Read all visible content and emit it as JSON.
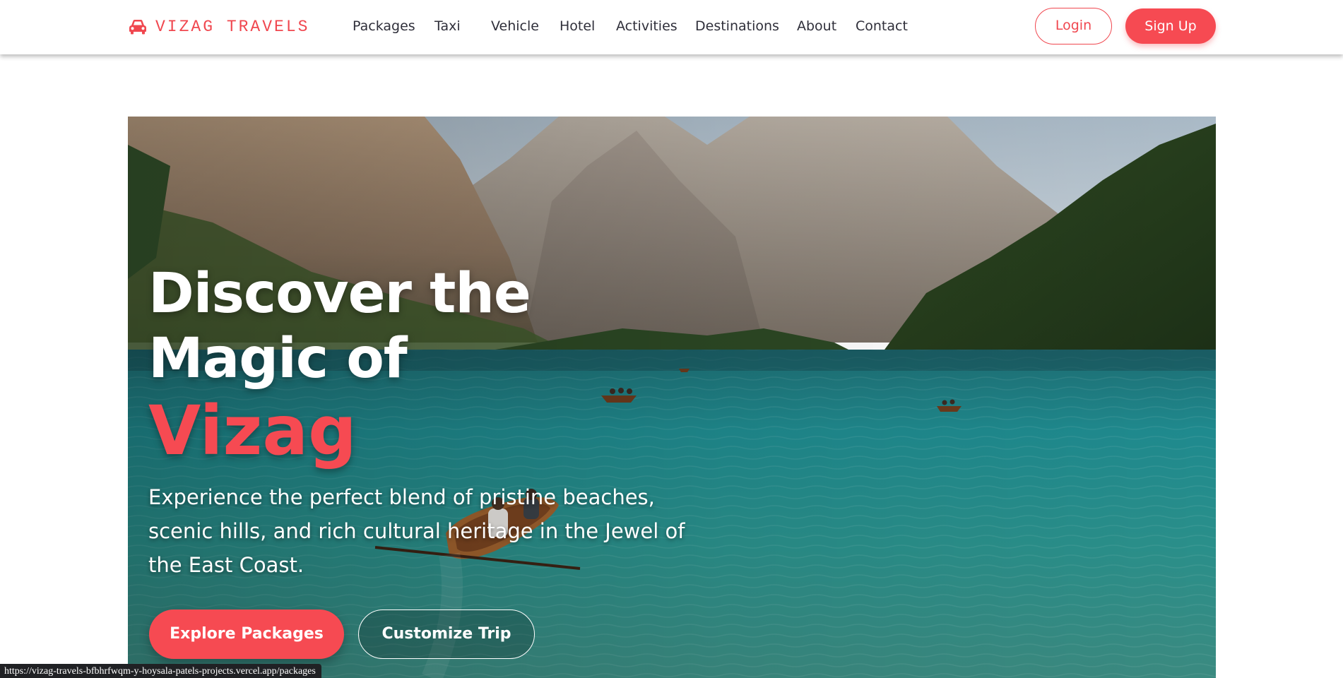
{
  "brand": {
    "name": "VIZAG TRAVELS",
    "icon": "car-icon",
    "color": "#f0474f"
  },
  "nav": {
    "links": [
      "Packages",
      "Taxi",
      "Vehicle",
      "Hotel",
      "Activities",
      "Destinations",
      "About",
      "Contact"
    ],
    "login_label": "Login",
    "signup_label": "Sign Up"
  },
  "hero": {
    "title": "Discover the Magic of",
    "highlight": "Vizag",
    "subtitle": "Experience the perfect blend of pristine beaches, scenic hills, and rich cultural heritage in the Jewel of the East Coast.",
    "primary_cta": "Explore Packages",
    "secondary_cta": "Customize Trip",
    "background": "mountain-lake-with-boats"
  },
  "status_bar": {
    "url": "https://vizag-travels-bfbhrfwqm-y-hoysala-patels-projects.vercel.app/packages"
  },
  "colors": {
    "accent": "#f64a52",
    "text_dark": "#2f2f3a",
    "white": "#ffffff"
  }
}
